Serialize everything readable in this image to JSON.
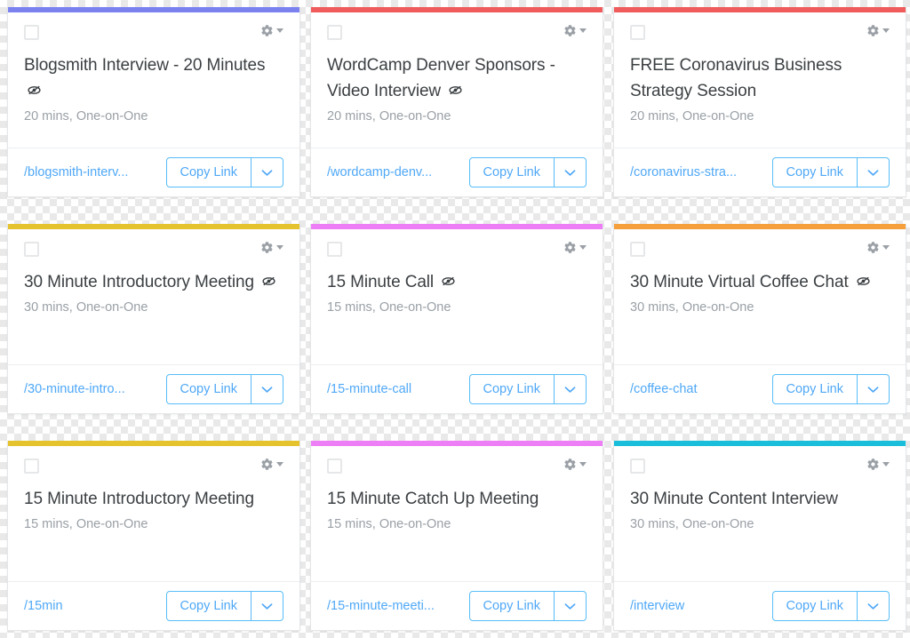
{
  "ui": {
    "copy_link_label": "Copy Link",
    "gear_icon": "gear-icon",
    "caret_icon": "chevron-down-icon",
    "checkbox_icon": "checkbox-unchecked",
    "hidden_icon": "eye-slash-icon"
  },
  "colors": {
    "purple": "#7b82f0",
    "red": "#f05b5b",
    "yellow": "#e5c32e",
    "magenta": "#ee7ef6",
    "orange": "#f5a03c",
    "cyan": "#1abedb",
    "link_blue": "#4fa8f7",
    "border_blue": "#57bdf8",
    "title_gray": "#3c4043",
    "meta_gray": "#9aa0a6"
  },
  "event_types": [
    {
      "title": "Blogsmith Interview - 20 Minutes",
      "hidden": true,
      "meta": "20 mins, One-on-One",
      "slug": "/blogsmith-interv...",
      "accent": "#7b82f0",
      "accent_name": "purple"
    },
    {
      "title": "WordCamp Denver Sponsors - Video Interview",
      "hidden": true,
      "meta": "20 mins, One-on-One",
      "slug": "/wordcamp-denv...",
      "accent": "#f05b5b",
      "accent_name": "red"
    },
    {
      "title": "FREE Coronavirus Business Strategy Session",
      "hidden": false,
      "meta": "20 mins, One-on-One",
      "slug": "/coronavirus-stra...",
      "accent": "#f05b5b",
      "accent_name": "red"
    },
    {
      "title": "30 Minute Introductory Meeting",
      "hidden": true,
      "meta": "30 mins, One-on-One",
      "slug": "/30-minute-intro...",
      "accent": "#e5c32e",
      "accent_name": "yellow"
    },
    {
      "title": "15 Minute Call",
      "hidden": true,
      "meta": "15 mins, One-on-One",
      "slug": "/15-minute-call",
      "accent": "#ee7ef6",
      "accent_name": "magenta"
    },
    {
      "title": "30 Minute Virtual Coffee Chat",
      "hidden": true,
      "meta": "30 mins, One-on-One",
      "slug": "/coffee-chat",
      "accent": "#f5a03c",
      "accent_name": "orange"
    },
    {
      "title": "15 Minute Introductory Meeting",
      "hidden": false,
      "meta": "15 mins, One-on-One",
      "slug": "/15min",
      "accent": "#e5c32e",
      "accent_name": "yellow"
    },
    {
      "title": "15 Minute Catch Up Meeting",
      "hidden": false,
      "meta": "15 mins, One-on-One",
      "slug": "/15-minute-meeti...",
      "accent": "#ee7ef6",
      "accent_name": "magenta"
    },
    {
      "title": "30 Minute Content Interview",
      "hidden": false,
      "meta": "30 mins, One-on-One",
      "slug": "/interview",
      "accent": "#1abedb",
      "accent_name": "cyan"
    }
  ]
}
